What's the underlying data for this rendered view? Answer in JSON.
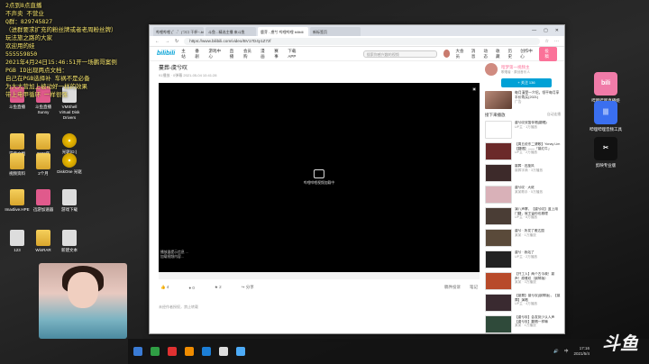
{
  "overlay_lines": [
    "2点到8点直播",
    "不声卖  不营业",
    "Q群：829745827",
    "（进群要求扩充的粉丝牌或者老周粉丝牌）",
    "玩法旅之路的大家",
    "欢迎用的娃",
    "555559850",
    "2021年4月24日15:46:51开一场鹏哥案例",
    "PGB  ID出现两点文档：",
    "自己在PGB选择补 车祸不是必备",
    "为大大营加上被动好一样的效果",
    "带上电甲循环  一样很强"
  ],
  "desktop_icons": [
    {
      "label": "斗鱼直播",
      "kind": "app-pink"
    },
    {
      "label": "斗鱼直播Sunny",
      "kind": "app-pink"
    },
    {
      "label": "VMShell Virtual Disk Drivers",
      "kind": "doc"
    },
    {
      "label": "学要文档",
      "kind": "folder"
    },
    {
      "label": "2020年",
      "kind": "folder"
    },
    {
      "label": "光驱(D:)",
      "kind": "disc"
    },
    {
      "label": "视频资料",
      "kind": "folder"
    },
    {
      "label": "2个月",
      "kind": "folder"
    },
    {
      "label": "DiskOne 光驱",
      "kind": "disc"
    },
    {
      "label": "Ima4live.HPE",
      "kind": "folder"
    },
    {
      "label": "迅游加速器",
      "kind": "app-pink"
    },
    {
      "label": "游戏下载",
      "kind": "doc"
    },
    {
      "label": "123",
      "kind": "doc"
    },
    {
      "label": "WinRAR",
      "kind": "folder"
    },
    {
      "label": "新建文本",
      "kind": "doc"
    }
  ],
  "right_icons": [
    {
      "label": "哔哩哔哩直播姬",
      "color": "#f07ba8",
      "text": "bili"
    },
    {
      "label": "哔哩哔哩音频工具",
      "color": "#3a6ff0",
      "text": "|||"
    },
    {
      "label": "剪映专业版",
      "color": "#111111",
      "text": "✂"
    }
  ],
  "browser": {
    "tabs": [
      "哔哩哔哩 (゜-゜)つロ 干杯~-bili",
      "斗鱼 - 精选主播 来斗鱼",
      "鹿芽 - 虞兮 哔哩哔哩 bilibili",
      "新标签页"
    ],
    "url": "https://www.bilibili.com/video/BV17D4y1Z7zf",
    "nav": {
      "logo": "bilibili",
      "links": [
        "主站",
        "番剧",
        "游戏中心",
        "直播",
        "会员购",
        "漫画",
        "赛事",
        "下载APP"
      ],
      "search_placeholder": "搜索你感兴趣的视频",
      "right_links": [
        "大会员",
        "消息",
        "动态",
        "收藏",
        "历史",
        "创作中心"
      ],
      "upload": "投稿"
    },
    "video": {
      "title": "蔓葬-虞兮叹",
      "meta": "91播放 · 0弹幕    2021-05-04 10:41:28",
      "player_message": "哔哩哔哩视频加载中",
      "player_tip_1": "播放器提示信息 ...",
      "player_tip_2": "加载视频内容...",
      "likes": "4",
      "coins": "0",
      "favorites": "2",
      "share": "分享",
      "report": "稿件投诉",
      "notes": "笔记",
      "footer_note": "未经作者授权，禁止转载"
    },
    "uploader": {
      "name": "暗梦第一视频主",
      "desc": "歌唱者 · 原创音乐人",
      "follow": "+ 关注 136"
    },
    "ad": {
      "title": "每月清楚一介绍，领平每月享半价购买(2021)",
      "sub": "广告"
    },
    "list": {
      "header": "接下来播放",
      "autoplay": "自动连播"
    },
    "recommendations": [
      {
        "title": "虞兮叹双笛伴唱(翻唱)",
        "sub": "UP主 · 1万播放",
        "color": "#ffffff"
      },
      {
        "title": "【周五说东二婆歌】Yonay Lim【翻唱】——「蔓红牛」",
        "sub": "UP主 · 2万播放",
        "color": "#6b2a2a"
      },
      {
        "title": "蔓葬 · 迟旋风",
        "sub": "蔓葬字典 · 3万播放",
        "color": "#3d2a2a"
      },
      {
        "title": "虞兮叹 · 大佬",
        "sub": "某某歌手 · 5万播放",
        "color": "#d9b1b8"
      },
      {
        "title": "演八声寨，【虞兮叹】蓝上用门翻，就王留你也雅理",
        "sub": "UP主 · 8万播放",
        "color": "#4a3d35"
      },
      {
        "title": "虞兮 · 所发了雅达国",
        "sub": "某某 · 1万播放",
        "color": "#5a4a3a"
      },
      {
        "title": "虞兮 · 我站了",
        "sub": "UP主 · 2万播放",
        "color": "#222222"
      },
      {
        "title": "【开工人】两个古今故！蔓声！原雅叹（钢琴版）",
        "sub": "某某 · 3万播放",
        "color": "#b84a2a"
      },
      {
        "title": "【蔓葬】蔓兮叹(钢琴版)，【蔓葬】演唱",
        "sub": "UP主 · 4万播放",
        "color": "#3a2a30"
      },
      {
        "title": "【虞兮叹】会发到少认人声【虞兮叹】翻唱一样嘛",
        "sub": "某某 · 1万播放",
        "color": "#2f4a3a"
      }
    ]
  },
  "taskbar": {
    "tray_lang": "中",
    "time": "17:16",
    "date": "2021/5/4"
  },
  "watermark": "斗鱼"
}
